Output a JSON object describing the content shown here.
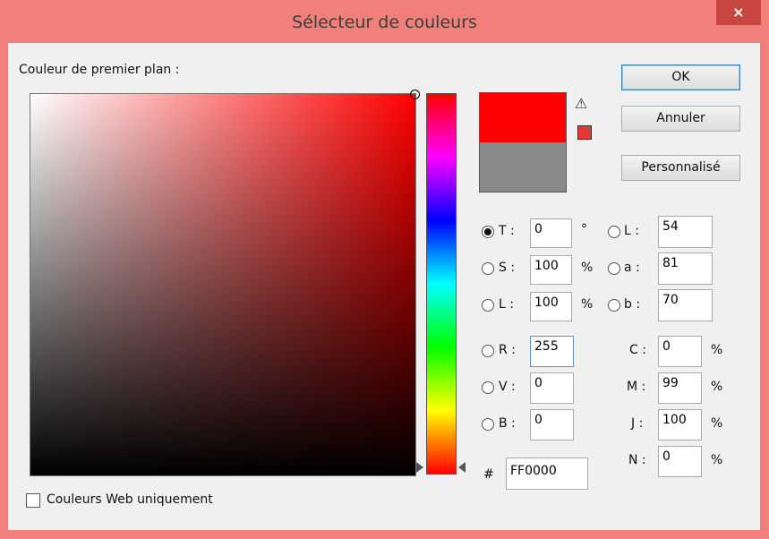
{
  "window": {
    "title": "Sélecteur de couleurs",
    "close": "×"
  },
  "picker": {
    "label": "Couleur de premier plan :"
  },
  "buttons": {
    "ok": "OK",
    "cancel": "Annuler",
    "custom": "Personnalisé"
  },
  "preview": {
    "new_color": "#ff0000",
    "current_color": "#898989",
    "gamut_warning": "⚠",
    "gamut_swatch": "#e53935"
  },
  "hsb": [
    {
      "label": "T :",
      "value": "0",
      "unit": "°",
      "checked": true
    },
    {
      "label": "S :",
      "value": "100",
      "unit": "%",
      "checked": false
    },
    {
      "label": "L :",
      "value": "100",
      "unit": "%",
      "checked": false
    }
  ],
  "lab": [
    {
      "label": "L :",
      "value": "54"
    },
    {
      "label": "a :",
      "value": "81"
    },
    {
      "label": "b :",
      "value": "70"
    }
  ],
  "rgb": [
    {
      "label": "R :",
      "value": "255"
    },
    {
      "label": "V :",
      "value": "0"
    },
    {
      "label": "B :",
      "value": "0"
    }
  ],
  "cmyk": [
    {
      "label": "C :",
      "value": "0",
      "unit": "%"
    },
    {
      "label": "M :",
      "value": "99",
      "unit": "%"
    },
    {
      "label": "J :",
      "value": "100",
      "unit": "%"
    },
    {
      "label": "N :",
      "value": "0",
      "unit": "%"
    }
  ],
  "hex": {
    "label": "#",
    "value": "FF0000"
  },
  "web_only": {
    "label": "Couleurs Web uniquement",
    "checked": false
  }
}
